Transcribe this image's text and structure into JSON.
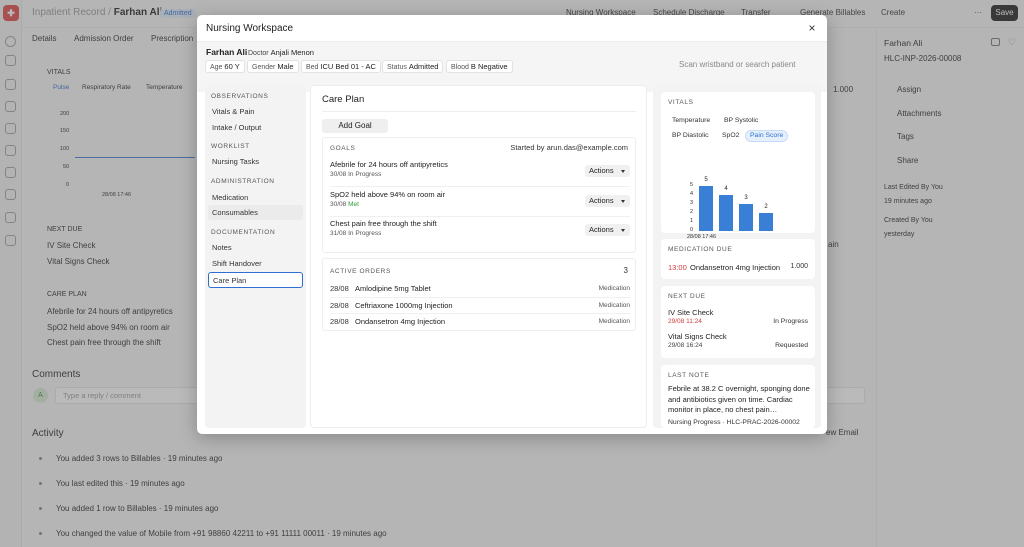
{
  "app": {
    "breadcrumb_parent": "Inpatient Record",
    "breadcrumb_sep": "/",
    "breadcrumb_current": "Farhan Ali",
    "status_badge": "Admitted",
    "accent": "#2f6fd1",
    "brand": "#e04848"
  },
  "toolbar": {
    "nursing_workspace": "Nursing Workspace",
    "schedule_discharge": "Schedule Discharge",
    "transfer": "Transfer",
    "generate_billables": "Generate Billables",
    "create": "Create",
    "more": "···",
    "save": "Save"
  },
  "bg_tabs": [
    "Details",
    "Admission Order",
    "Prescription"
  ],
  "bg": {
    "vitals_label": "VITALS",
    "vitals_tabs": [
      "Pulse",
      "Respiratory Rate",
      "Temperature"
    ],
    "y_ticks": [
      "200",
      "150",
      "100",
      "50",
      "0"
    ],
    "x_tick": "28/08 17:46",
    "next_due_label": "NEXT DUE",
    "next_due": [
      "IV Site Check",
      "Vital Signs Check"
    ],
    "care_plan_label": "CARE PLAN",
    "care_plan": [
      "Afebrile for 24 hours off antipyretics",
      "SpO2 held above 94% on room air",
      "Chest pain free through the shift"
    ],
    "value_right": "1.000",
    "frag_ain": "ain",
    "frag_email": "ew Email",
    "comments_label": "Comments",
    "avatar_letter": "A",
    "comment_placeholder": "Type a reply / comment",
    "activity_label": "Activity",
    "activity": [
      "You added 3 rows to Billables · 19 minutes ago",
      "You last edited this · 19 minutes ago",
      "You added 1 row to Billables · 19 minutes ago",
      "You changed the value of Mobile from +91 98860 42211 to +91 11111 00011 · 19 minutes ago"
    ]
  },
  "right_panel": {
    "name": "Farhan Ali",
    "id": "HLC-INP-2026-00008",
    "assign": "Assign",
    "attachments": "Attachments",
    "tags": "Tags",
    "share": "Share",
    "last_edited_label": "Last Edited By You",
    "last_edited_time": "19 minutes ago",
    "created_label": "Created By You",
    "created_time": "yesterday"
  },
  "modal": {
    "title": "Nursing Workspace",
    "close": "×",
    "patient": {
      "name": "Farhan Ali",
      "doctor_label": "Doctor",
      "doctor": "Anjali Menon"
    },
    "chips": [
      {
        "label": "Age",
        "value": "60 Y"
      },
      {
        "label": "Gender",
        "value": "Male"
      },
      {
        "label": "Bed",
        "value": "ICU Bed 01 - AC"
      },
      {
        "label": "Status",
        "value": "Admitted"
      },
      {
        "label": "Blood",
        "value": "B Negative"
      }
    ],
    "scan_placeholder": "Scan wristband or search patient",
    "nav": {
      "observations": "OBSERVATIONS",
      "vitals_pain": "Vitals & Pain",
      "intake_output": "Intake / Output",
      "worklist": "WORKLIST",
      "nursing_tasks": "Nursing Tasks",
      "administration": "ADMINISTRATION",
      "medication": "Medication",
      "consumables": "Consumables",
      "documentation": "DOCUMENTATION",
      "notes": "Notes",
      "shift_handover": "Shift Handover",
      "care_plan": "Care Plan"
    },
    "care_plan": {
      "title": "Care Plan",
      "add_goal": "Add Goal",
      "goals_label": "GOALS",
      "started_by": "Started by arun.das@example.com",
      "goals": [
        {
          "name": "Afebrile for 24 hours off antipyretics",
          "date": "30/08",
          "status": "In Progress",
          "action": "Actions"
        },
        {
          "name": "SpO2 held above 94% on room air",
          "date": "30/08",
          "status": "Met",
          "action": "Actions"
        },
        {
          "name": "Chest pain free through the shift",
          "date": "31/08",
          "status": "In Progress",
          "action": "Actions"
        }
      ],
      "orders_label": "ACTIVE ORDERS",
      "orders_count": "3",
      "orders": [
        {
          "date": "28/08",
          "name": "Amlodipine 5mg Tablet",
          "type": "Medication"
        },
        {
          "date": "28/08",
          "name": "Ceftriaxone 1000mg Injection",
          "type": "Medication"
        },
        {
          "date": "28/08",
          "name": "Ondansetron 4mg Injection",
          "type": "Medication"
        }
      ]
    },
    "vitals_card": {
      "label": "VITALS",
      "tabs": [
        "Temperature",
        "BP Systolic",
        "BP Diastolic",
        "SpO2",
        "Pain Score"
      ],
      "active_tab": "Pain Score"
    },
    "medication_due": {
      "label": "MEDICATION DUE",
      "time": "13:00",
      "name": "Ondansetron 4mg Injection",
      "qty": "1.000",
      "time_color": "#d23c3c"
    },
    "next_due": {
      "label": "NEXT DUE",
      "items": [
        {
          "name": "IV Site Check",
          "when": "29/08 11:24",
          "status": "In Progress",
          "when_color": "#d23c3c"
        },
        {
          "name": "Vital Signs Check",
          "when": "29/08 16:24",
          "status": "Requested",
          "when_color": "#444444"
        }
      ]
    },
    "last_note": {
      "label": "LAST NOTE",
      "text": "Febrile at 38.2 C overnight, sponging done and antibiotics given on time. Cardiac monitor in place, no chest pain…",
      "footer": "Nursing Progress · HLC-PRAC-2026-00002"
    }
  },
  "chart_data": {
    "type": "bar",
    "title": "",
    "categories": [
      "28/08 17:46",
      "",
      "",
      ""
    ],
    "x_tick_labels": [
      "28/08 17:46"
    ],
    "series": [
      {
        "values": [
          5,
          4,
          3,
          2
        ]
      }
    ],
    "data_labels": [
      "5",
      "4",
      "3",
      "2"
    ],
    "y_ticks": [
      "5",
      "4",
      "3",
      "2",
      "1",
      "0"
    ],
    "ylim": [
      0,
      5
    ],
    "xlabel": "",
    "ylabel": "",
    "color": "#3a7fd6",
    "grid": false,
    "legend": "none"
  }
}
